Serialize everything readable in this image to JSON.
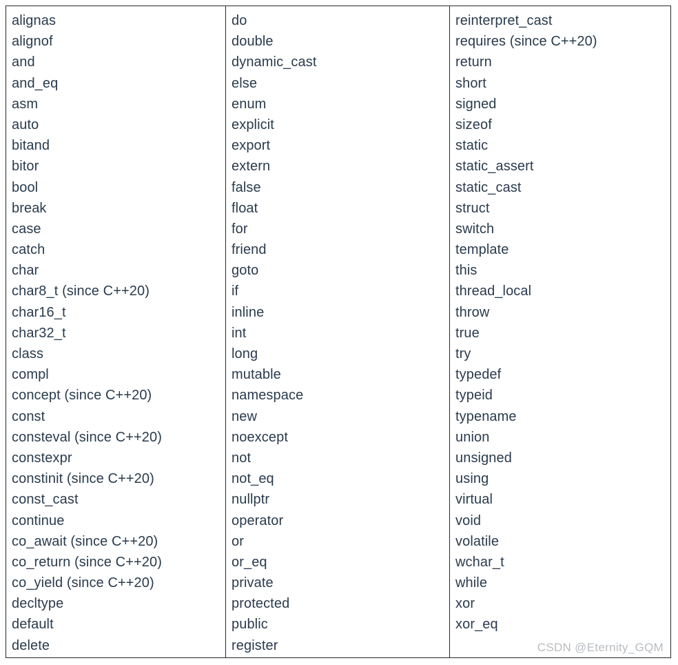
{
  "table": {
    "border_color": "#23282d",
    "text_color": "#2a3b4d",
    "background_color": "#ffffff",
    "columns": [
      {
        "name": "column-1",
        "items": [
          "alignas",
          "alignof",
          "and",
          "and_eq",
          "asm",
          "auto",
          "bitand",
          "bitor",
          "bool",
          "break",
          "case",
          "catch",
          "char",
          "char8_t (since C++20)",
          "char16_t",
          "char32_t",
          "class",
          "compl",
          "concept (since C++20)",
          "const",
          "consteval (since C++20)",
          "constexpr",
          "constinit (since C++20)",
          "const_cast",
          "continue",
          "co_await (since C++20)",
          "co_return (since C++20)",
          "co_yield (since C++20)",
          "decltype",
          "default",
          "delete"
        ]
      },
      {
        "name": "column-2",
        "items": [
          "do",
          "double",
          "dynamic_cast",
          "else",
          "enum",
          "explicit",
          "export",
          "extern",
          "false",
          "float",
          "for",
          "friend",
          "goto",
          "if",
          "inline",
          "int",
          "long",
          "mutable",
          "namespace",
          "new",
          "noexcept",
          "not",
          "not_eq",
          "nullptr",
          "operator",
          "or",
          "or_eq",
          "private",
          "protected",
          "public",
          "register"
        ]
      },
      {
        "name": "column-3",
        "items": [
          "reinterpret_cast",
          "requires (since C++20)",
          "return",
          "short",
          "signed",
          "sizeof",
          "static",
          "static_assert",
          "static_cast",
          "struct",
          "switch",
          "template",
          "this",
          "thread_local",
          "throw",
          "true",
          "try",
          "typedef",
          "typeid",
          "typename",
          "union",
          "unsigned",
          "using",
          "virtual",
          "void",
          "volatile",
          "wchar_t",
          "while",
          "xor",
          "xor_eq"
        ]
      }
    ]
  },
  "watermark": {
    "text": "CSDN @Eternity_GQM",
    "color": "#b8bcc0"
  }
}
